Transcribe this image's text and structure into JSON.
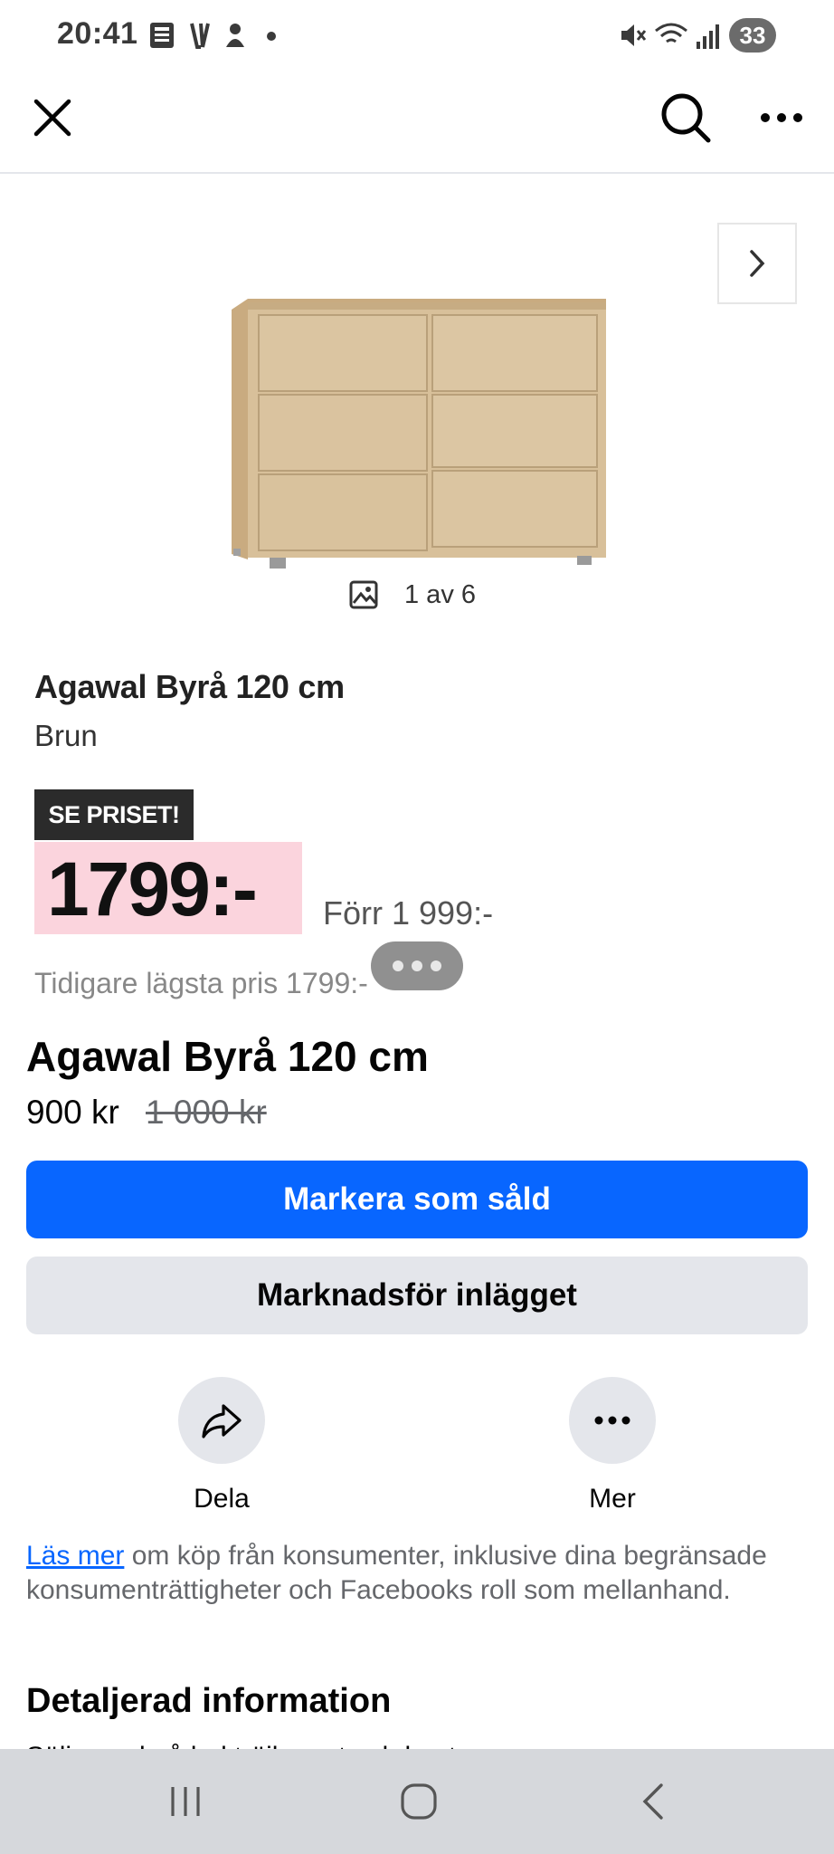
{
  "status_bar": {
    "time": "20:41",
    "battery": "33",
    "icons": [
      "news-icon",
      "v-app-icon",
      "notification-app-icon",
      "dot-icon",
      "mute-icon",
      "wifi-icon",
      "signal-icon"
    ]
  },
  "header": {
    "icons": [
      "close-icon",
      "search-icon",
      "more-icon"
    ]
  },
  "image": {
    "counter": "1 av 6",
    "next_icon": "chevron-right-icon"
  },
  "ad": {
    "title": "Agawal Byrå 120 cm",
    "color": "Brun",
    "badge": "SE PRISET!",
    "price": "1799:-",
    "former_price": "Förr 1 999:-",
    "lowest_price": "Tidigare lägsta pris 1799:-"
  },
  "listing": {
    "title": "Agawal Byrå 120 cm",
    "price": "900 kr",
    "old_price": "1 000 kr",
    "mark_sold_label": "Markera som såld",
    "promote_label": "Marknadsför inlägget"
  },
  "actions": {
    "share_label": "Dela",
    "more_label": "Mer"
  },
  "consumer_info": {
    "link_text": "Läs mer",
    "text": " om köp från konsumenter, inklusive dina begränsade konsumenträttigheter och Facebooks roll som mellanhand."
  },
  "details": {
    "heading": "Detaljerad information",
    "peek": "Säljs med på hel tröjkorset och bostan"
  },
  "colors": {
    "primary": "#0866ff",
    "secondary_button": "#e4e6eb",
    "price_highlight": "#fbd4dd"
  }
}
